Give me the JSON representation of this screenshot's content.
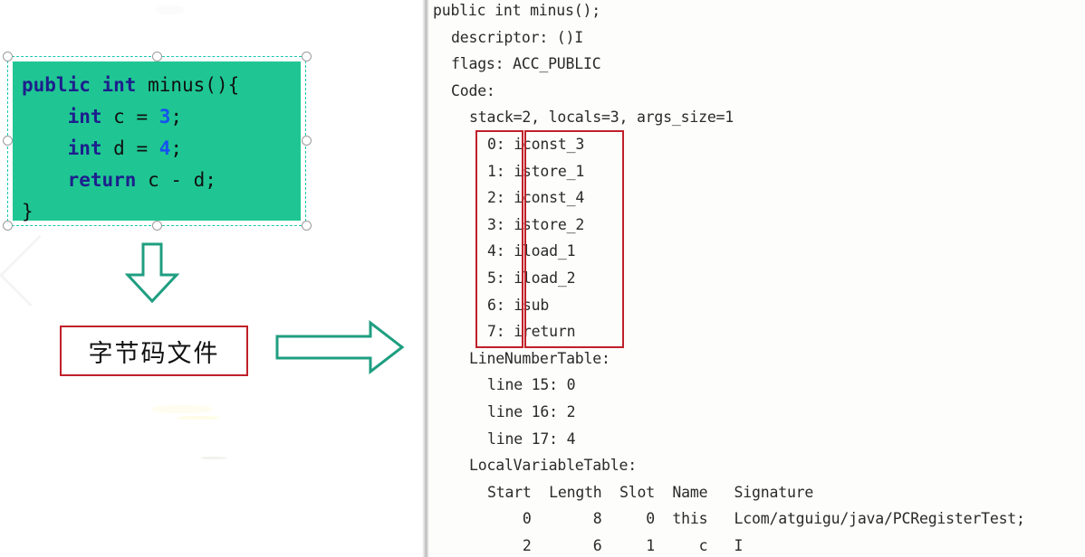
{
  "left": {
    "code_shape": {
      "background_color": "#1fc693",
      "keyword_color": "#1d1f8c",
      "number_color": "#1552f0",
      "lines": [
        {
          "text": "public int minus(){",
          "tokens": [
            {
              "t": "public",
              "c": "kw"
            },
            {
              "t": " ",
              "c": "id"
            },
            {
              "t": "int",
              "c": "kw"
            },
            {
              "t": " minus(){",
              "c": "id"
            }
          ]
        },
        {
          "text": "    int c = 3;",
          "tokens": [
            {
              "t": "    ",
              "c": "id"
            },
            {
              "t": "int",
              "c": "kw"
            },
            {
              "t": " c = ",
              "c": "id"
            },
            {
              "t": "3",
              "c": "num"
            },
            {
              "t": ";",
              "c": "id"
            }
          ]
        },
        {
          "text": "    int d = 4;",
          "tokens": [
            {
              "t": "    ",
              "c": "id"
            },
            {
              "t": "int",
              "c": "kw"
            },
            {
              "t": " d = ",
              "c": "id"
            },
            {
              "t": "4",
              "c": "num"
            },
            {
              "t": ";",
              "c": "id"
            }
          ]
        },
        {
          "text": "    return c - d;",
          "tokens": [
            {
              "t": "    ",
              "c": "id"
            },
            {
              "t": "return",
              "c": "kw"
            },
            {
              "t": " c - d;",
              "c": "id"
            }
          ]
        },
        {
          "text": "}",
          "tokens": [
            {
              "t": "}",
              "c": "id"
            }
          ]
        }
      ]
    },
    "bytecode_label": {
      "text": "字节码文件",
      "border_color": "#c0202a"
    },
    "arrows": {
      "down_arrow_color": "#1f9e80",
      "right_arrow_color": "#1f9e80",
      "down_arrow_name": "down-arrow",
      "right_arrow_name": "right-arrow"
    }
  },
  "right": {
    "accent_color": "#c0202a",
    "javap_lines": [
      {
        "indent": 0,
        "text": "public int minus();"
      },
      {
        "indent": 1,
        "text": "descriptor: ()I"
      },
      {
        "indent": 1,
        "text": "flags: ACC_PUBLIC"
      },
      {
        "indent": 1,
        "text": "Code:"
      },
      {
        "indent": 2,
        "text": "stack=2, locals=3, args_size=1"
      },
      {
        "indent": 3,
        "text": "0: iconst_3"
      },
      {
        "indent": 3,
        "text": "1: istore_1"
      },
      {
        "indent": 3,
        "text": "2: iconst_4"
      },
      {
        "indent": 3,
        "text": "3: istore_2"
      },
      {
        "indent": 3,
        "text": "4: iload_1"
      },
      {
        "indent": 3,
        "text": "5: iload_2"
      },
      {
        "indent": 3,
        "text": "6: isub"
      },
      {
        "indent": 3,
        "text": "7: ireturn"
      },
      {
        "indent": 2,
        "text": "LineNumberTable:"
      },
      {
        "indent": 3,
        "text": "line 15: 0"
      },
      {
        "indent": 3,
        "text": "line 16: 2"
      },
      {
        "indent": 3,
        "text": "line 17: 4"
      },
      {
        "indent": 2,
        "text": "LocalVariableTable:"
      },
      {
        "indent": 3,
        "text": "Start  Length  Slot  Name   Signature"
      },
      {
        "indent": 3,
        "text": "    0       8     0  this   Lcom/atguigu/java/PCRegisterTest;"
      },
      {
        "indent": 3,
        "text": "    2       6     1     c   I"
      }
    ],
    "bytecode_table": {
      "offsets": [
        "0",
        "1",
        "2",
        "3",
        "4",
        "5",
        "6",
        "7"
      ],
      "instructions": [
        "iconst_3",
        "istore_1",
        "iconst_4",
        "istore_2",
        "iload_1",
        "iload_2",
        "isub",
        "ireturn"
      ]
    },
    "line_number_table": {
      "rows": [
        {
          "line": "15",
          "pc": "0"
        },
        {
          "line": "16",
          "pc": "2"
        },
        {
          "line": "17",
          "pc": "4"
        }
      ]
    },
    "local_variable_table": {
      "headers": [
        "Start",
        "Length",
        "Slot",
        "Name",
        "Signature"
      ],
      "rows": [
        [
          "0",
          "8",
          "0",
          "this",
          "Lcom/atguigu/java/PCRegisterTest;"
        ],
        [
          "2",
          "6",
          "1",
          "c",
          "I"
        ]
      ]
    },
    "method": {
      "signature": "public int minus();",
      "descriptor": "()I",
      "flags": "ACC_PUBLIC",
      "stack": "2",
      "locals": "3",
      "args_size": "1"
    }
  }
}
